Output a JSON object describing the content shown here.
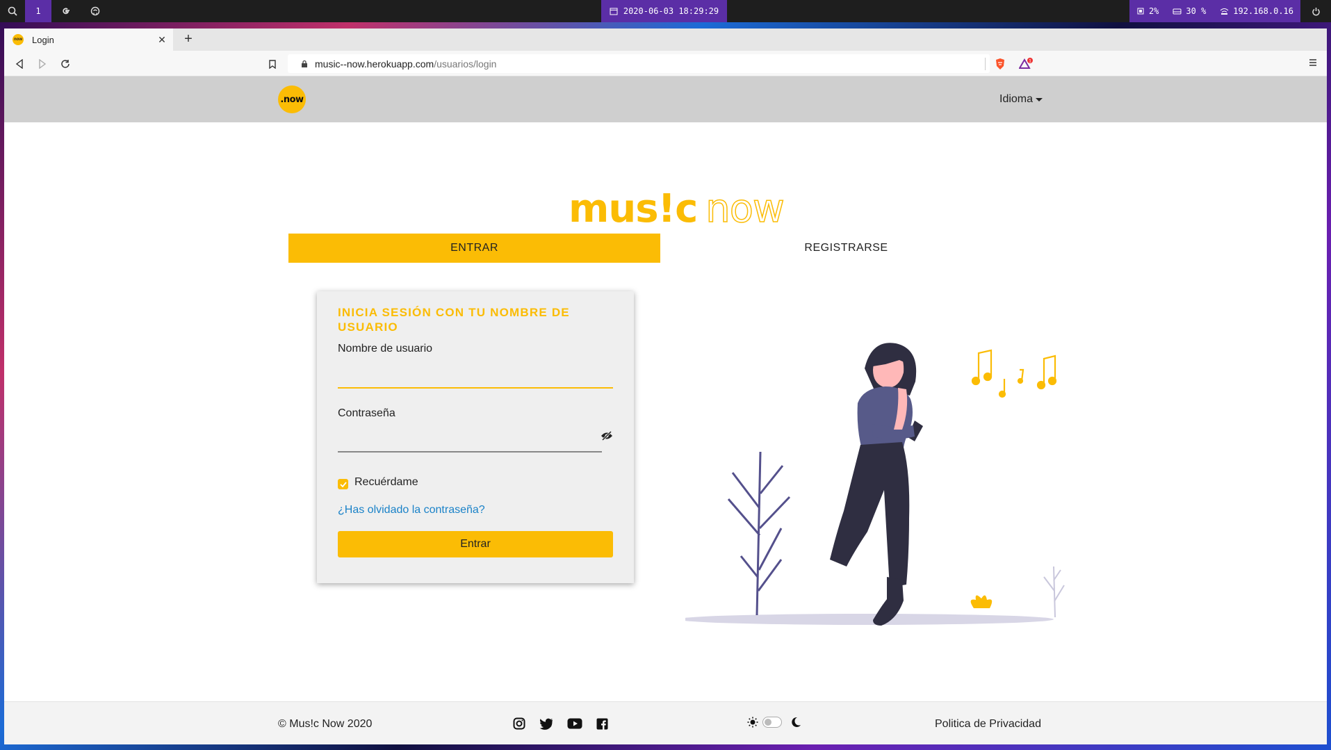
{
  "system_bar": {
    "workspace": "1",
    "clock": "2020-06-03 18:29:29",
    "cpu": "2%",
    "disk": "30 %",
    "ip": "192.168.0.16",
    "icons": [
      "search-icon",
      "google-icon",
      "github-icon",
      "calendar-icon",
      "cpu-icon",
      "disk-icon",
      "network-icon",
      "power-icon"
    ]
  },
  "browser": {
    "tab_title": "Login",
    "url_host": "music--now.herokuapp.com",
    "url_path": "/usuarios/login",
    "alert_count": "1"
  },
  "site": {
    "logo_text": ".now",
    "language_menu": "Idioma",
    "brand_part1": "mus!c",
    "brand_part2": "now",
    "tabs": {
      "login": "ENTRAR",
      "register": "REGISTRARSE"
    },
    "accent_color": "#fbbc05",
    "link_color": "#1a82c8"
  },
  "login_form": {
    "title": "INICIA SESIÓN CON TU NOMBRE DE USUARIO",
    "username_label": "Nombre de usuario",
    "username_value": "",
    "password_label": "Contraseña",
    "password_value": "",
    "remember_label": "Recuérdame",
    "remember_checked": true,
    "forgot_link": "¿Has olvidado la contraseña?",
    "submit": "Entrar"
  },
  "footer": {
    "copyright": "© Mus!c Now 2020",
    "socials": [
      "instagram-icon",
      "twitter-icon",
      "youtube-icon",
      "facebook-icon"
    ],
    "privacy": "Politica de Privacidad"
  }
}
